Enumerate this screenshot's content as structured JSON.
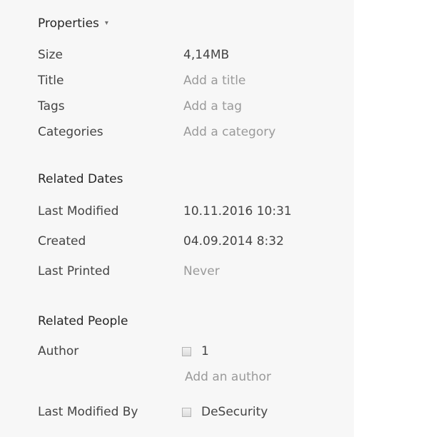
{
  "properties": {
    "title": "Properties",
    "dropdown_glyph": "▾",
    "rows": [
      {
        "label": "Size",
        "value": "4,14MB"
      },
      {
        "label": "Title",
        "value": "Add a title"
      },
      {
        "label": "Tags",
        "value": "Add a tag"
      },
      {
        "label": "Categories",
        "value": "Add a category"
      }
    ]
  },
  "related_dates": {
    "title": "Related Dates",
    "rows": [
      {
        "label": "Last Modified",
        "value": "10.11.2016 10:31"
      },
      {
        "label": "Created",
        "value": "04.09.2014 8:32"
      },
      {
        "label": "Last Printed",
        "value": "Never"
      }
    ]
  },
  "related_people": {
    "title": "Related People",
    "author_label": "Author",
    "author_name": "1",
    "add_author": "Add an author",
    "last_modified_by_label": "Last Modified By",
    "last_modified_by_name": "DeSecurity"
  }
}
